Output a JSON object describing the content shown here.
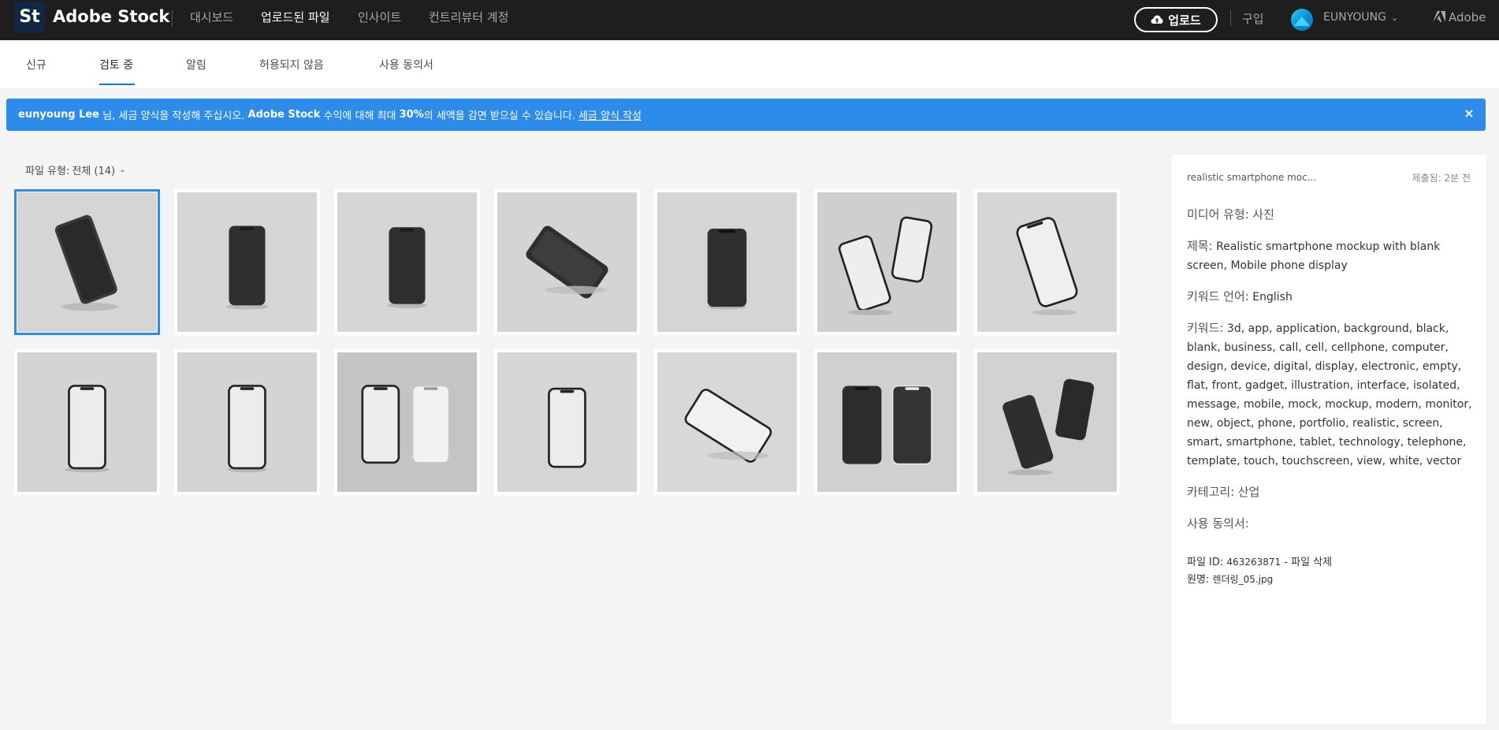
{
  "topbar": {
    "logo_mark": "St",
    "brand": "Adobe Stock",
    "nav": [
      "대시보드",
      "업로드된 파일",
      "인사이트",
      "컨트리뷰터 계정"
    ],
    "upload_label": "업로드",
    "buy_label": "구입",
    "username": "EUNYOUNG",
    "adobe_label": "Adobe"
  },
  "subtabs": [
    "신규",
    "검토 중",
    "알림",
    "허용되지 않음",
    "사용 동의서"
  ],
  "banner": {
    "name": "eunyoung Lee",
    "text_a": " 님, 세금 양식을 작성해 주십시오. ",
    "brand": "Adobe Stock",
    "text_b": " 수익에 대해 최대 ",
    "percent": "30%",
    "text_c": "의 세액을 감면 받으실 수 있습니다.",
    "link": "세금 양식 작성",
    "close": "×"
  },
  "filter": {
    "label": "파일 유형:",
    "value": "전체 (14)"
  },
  "grid": {
    "count": 14,
    "selected_index": 0,
    "thumb_bg": "#d4d4d4"
  },
  "panel": {
    "title": "realistic smartphone moc...",
    "submitted": "제출됨: 2분 전",
    "media_label": "미디어 유형:",
    "media_value": "사진",
    "title_label": "제목:",
    "title_value": "Realistic smartphone mockup with blank screen, Mobile phone display",
    "kwlang_label": "키워드 언어:",
    "kwlang_value": "English",
    "keywords_label": "키워드:",
    "keywords_value": "3d, app, application, background, black, blank, business, call, cell, cellphone, computer, design, device, digital, display, electronic, empty, flat, front, gadget, illustration, interface, isolated, message, mobile, mock, mockup, modern, monitor, new, object, phone, portfolio, realistic, screen, smart, smartphone, tablet, technology, telephone, template, touch, touchscreen, view, white, vector",
    "category_label": "카테고리:",
    "category_value": "산업",
    "release_label": "사용 동의서:",
    "file_id_label": "파일 ID:",
    "file_id_value": "463263871",
    "delete_link": "파일 삭제",
    "original_label": "원명:",
    "original_value": "렌더링_05.jpg"
  },
  "colors": {
    "topbar": "#1e1e1e",
    "accent": "#1473e6",
    "banner": "#2d8ceb"
  }
}
